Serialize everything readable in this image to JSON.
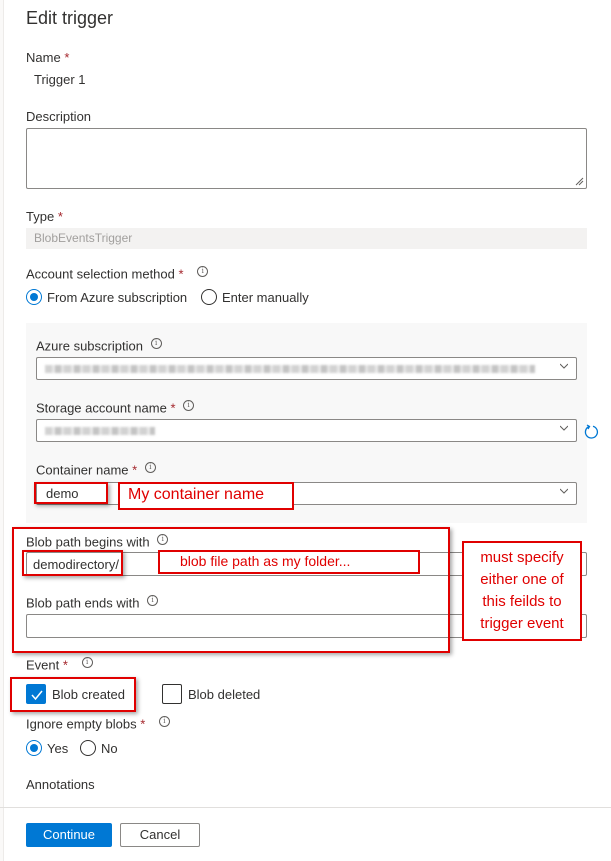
{
  "title": "Edit trigger",
  "name": {
    "label": "Name",
    "required": "*",
    "value": "Trigger 1"
  },
  "description": {
    "label": "Description",
    "value": ""
  },
  "type": {
    "label": "Type",
    "required": "*",
    "value": "BlobEventsTrigger"
  },
  "account_selection": {
    "label": "Account selection method",
    "required": "*",
    "options": [
      {
        "label": "From Azure subscription",
        "selected": true
      },
      {
        "label": "Enter manually",
        "selected": false
      }
    ]
  },
  "azure_subscription": {
    "label": "Azure subscription",
    "value": "(redacted)"
  },
  "storage_account": {
    "label": "Storage account name",
    "required": "*",
    "value": "(redacted)"
  },
  "container": {
    "label": "Container name",
    "required": "*",
    "value": "demo"
  },
  "blob_begins": {
    "label": "Blob path begins with",
    "value": "demodirectory/"
  },
  "blob_ends": {
    "label": "Blob path ends with",
    "value": ""
  },
  "event": {
    "label": "Event",
    "required": "*",
    "options": [
      {
        "label": "Blob created",
        "checked": true
      },
      {
        "label": "Blob deleted",
        "checked": false
      }
    ]
  },
  "ignore_empty": {
    "label": "Ignore empty blobs",
    "required": "*",
    "options": [
      {
        "label": "Yes",
        "selected": true
      },
      {
        "label": "No",
        "selected": false
      }
    ]
  },
  "annotations": {
    "label": "Annotations"
  },
  "buttons": {
    "continue": "Continue",
    "cancel": "Cancel"
  },
  "callouts": {
    "container": "My container name",
    "blob_path": "blob file path as my folder...",
    "must_specify": [
      "must specify",
      "either one of",
      "this feilds to",
      "trigger event"
    ]
  },
  "colors": {
    "accent": "#0078d4",
    "annotation": "#e00000",
    "required": "#a4262c"
  }
}
